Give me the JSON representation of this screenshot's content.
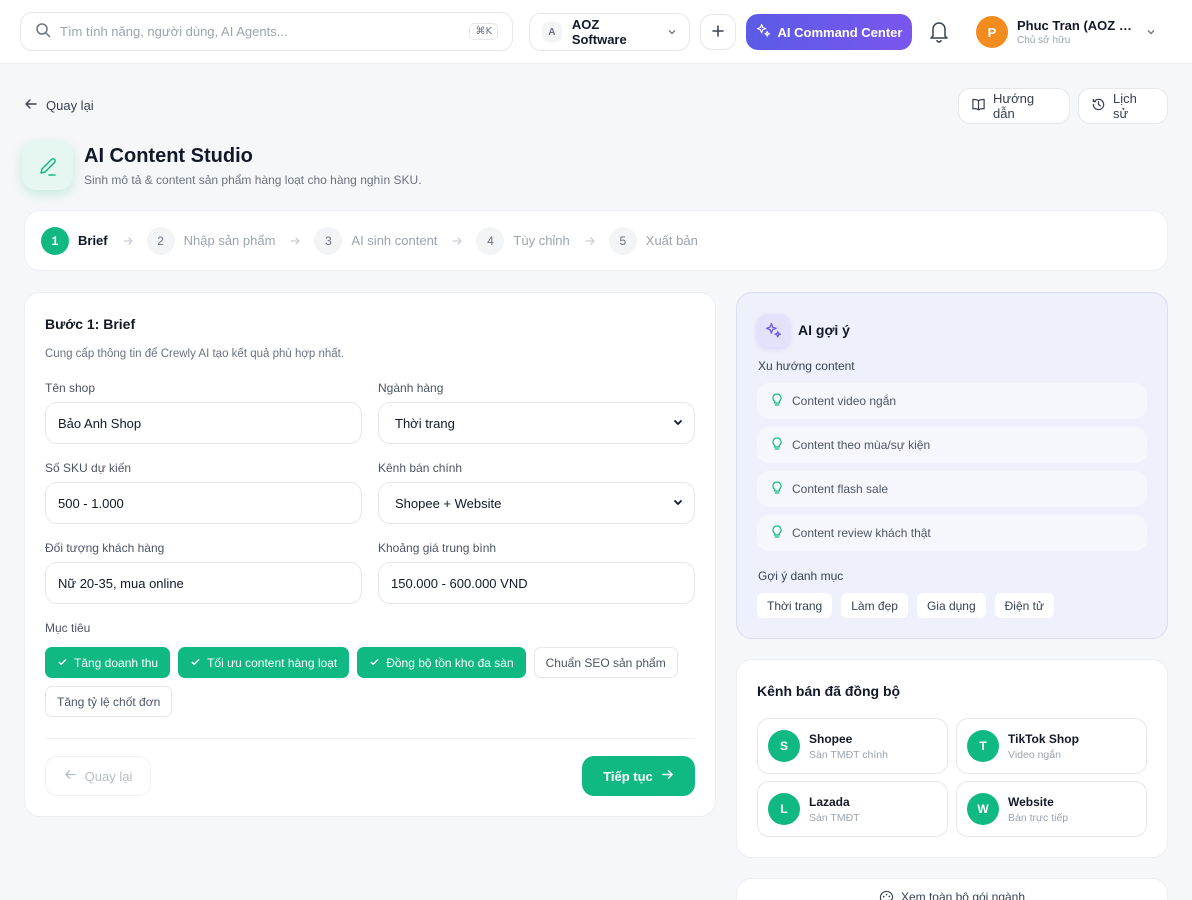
{
  "topbar": {
    "search_placeholder": "Tìm tính năng, người dùng, AI Agents...",
    "search_shortcut": "⌘K",
    "org_initial": "A",
    "org_name": "AOZ Software",
    "command_center_label": "AI Command Center",
    "user_initial": "P",
    "user_name": "Phuc Tran (AOZ Software)",
    "user_role": "Chủ sở hữu"
  },
  "page": {
    "back_label": "Quay lại",
    "guide_label": "Hướng dẫn",
    "history_label": "Lịch sử",
    "title": "AI Content Studio",
    "subtitle": "Sinh mô tả & content sản phẩm hàng loạt cho hàng nghìn SKU."
  },
  "steps": [
    {
      "num": "1",
      "label": "Brief",
      "active": true
    },
    {
      "num": "2",
      "label": "Nhập sản phẩm",
      "active": false
    },
    {
      "num": "3",
      "label": "AI sinh content",
      "active": false
    },
    {
      "num": "4",
      "label": "Tùy chỉnh",
      "active": false
    },
    {
      "num": "5",
      "label": "Xuất bản",
      "active": false
    }
  ],
  "form": {
    "title": "Bước 1: Brief",
    "description": "Cung cấp thông tin để Crewly AI tạo kết quả phù hợp nhất.",
    "shop_name_label": "Tên shop",
    "shop_name_value": "Bảo Anh Shop",
    "industry_label": "Ngành hàng",
    "industry_value": "Thời trang",
    "sku_label": "Số SKU dự kiến",
    "sku_value": "500 - 1.000",
    "channel_label": "Kênh bán chính",
    "channel_value": "Shopee + Website",
    "audience_label": "Đối tượng khách hàng",
    "audience_value": "Nữ 20-35, mua online",
    "price_label": "Khoảng giá trung bình",
    "price_value": "150.000 - 600.000 VND",
    "goals_label": "Mục tiêu",
    "goals": [
      {
        "label": "Tăng doanh thu",
        "selected": true
      },
      {
        "label": "Tối ưu content hàng loạt",
        "selected": true
      },
      {
        "label": "Đồng bộ tồn kho đa sàn",
        "selected": true
      },
      {
        "label": "Chuẩn SEO sản phẩm",
        "selected": false
      },
      {
        "label": "Tăng tỷ lệ chốt đơn",
        "selected": false
      }
    ],
    "back_button": "Quay lại",
    "next_button": "Tiếp tục"
  },
  "ai_suggest": {
    "title": "AI gợi ý",
    "trends_label": "Xu hướng content",
    "trends": [
      "Content video ngắn",
      "Content theo mùa/sự kiện",
      "Content flash sale",
      "Content review khách thật"
    ],
    "categories_label": "Gợi ý danh mục",
    "categories": [
      "Thời trang",
      "Làm đẹp",
      "Gia dụng",
      "Điện tử"
    ]
  },
  "channels": {
    "title": "Kênh bán đã đồng bộ",
    "items": [
      {
        "initial": "S",
        "name": "Shopee",
        "sub": "Sàn TMĐT chính"
      },
      {
        "initial": "T",
        "name": "TikTok Shop",
        "sub": "Video ngắn"
      },
      {
        "initial": "L",
        "name": "Lazada",
        "sub": "Sàn TMĐT"
      },
      {
        "initial": "W",
        "name": "Website",
        "sub": "Bán trực tiếp"
      }
    ]
  },
  "industry_pack_label": "Xem toàn bộ gói ngành",
  "colors": {
    "primary": "#10b981",
    "accent": "#6b5be9",
    "ai_panel": "#eef1fb"
  }
}
